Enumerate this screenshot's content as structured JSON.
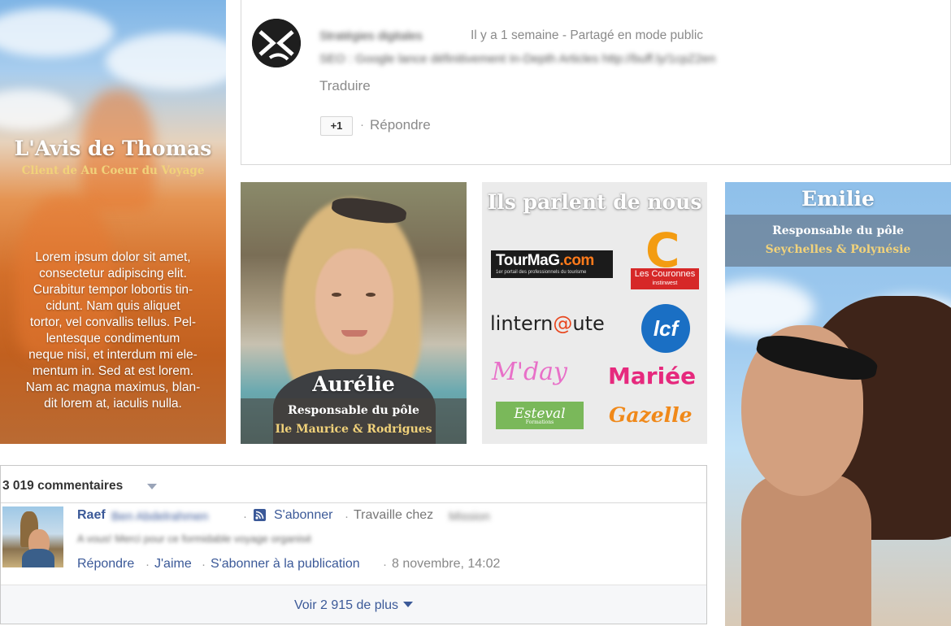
{
  "testimonial": {
    "title": "L'Avis de Thomas",
    "subtitle": "Client de Au Coeur du Voyage",
    "body_lines": [
      "Lorem ipsum dolor sit amet,",
      "consectetur adipiscing elit.",
      "Curabitur tempor lobortis tin-",
      "cidunt. Nam quis aliquet",
      "tortor, vel convallis tellus. Pel-",
      "lentesque condimentum",
      "neque nisi, et interdum mi ele-",
      "mentum in. Sed at est lorem.",
      "Nam ac magna maximus, blan-",
      "dit lorem at, iaculis nulla."
    ]
  },
  "google_comment": {
    "author": "Stratégies digitales",
    "meta": "Il y a 1 semaine  -  Partagé en mode public",
    "content": "SEO : Google lance définitivement In-Depth Articles http://buff.ly/1cpZ2en",
    "translate_label": "Traduire",
    "plus_one_label": "+1",
    "separator": "·",
    "reply_label": "Répondre"
  },
  "aurelie": {
    "name": "Aurélie",
    "role": "Responsable du pôle",
    "region": "Ile Maurice & Rodrigues"
  },
  "press": {
    "title": "Ils parlent de nous",
    "logos": {
      "tourmag_main": "TourMaG",
      "tourmag_dot": ".com",
      "tourmag_tagline": "1er portail des professionnels du tourisme",
      "couronnes_letter": "C",
      "couronnes_label": "Les Couronnes",
      "couronnes_sub": "instinwest",
      "linternaute_pre": "lintern",
      "linternaute_o": "@",
      "linternaute_post": "ute",
      "lcf": "lcf",
      "mday": "M'day",
      "mariee": "Mariée",
      "esteval": "Esteval",
      "esteval_sub": "Formations",
      "gazelle": "Gazelle"
    }
  },
  "emilie": {
    "name": "Emilie",
    "role": "Responsable du pôle",
    "region": "Seychelles & Polynésie"
  },
  "facebook": {
    "comment_count": "3 019 commentaires",
    "author_first": "Raef",
    "author_last": "Ben Abdelrahmen",
    "dot": "·",
    "subscribe_label": "S'abonner",
    "works_label": "Travaille chez",
    "employer": "Mission",
    "comment_text": "A vous! Merci pour ce formidable voyage organisé",
    "actions": {
      "reply": "Répondre",
      "like": "J'aime",
      "subscribe_post": "S'abonner à la publication"
    },
    "date": "8 novembre, 14:02",
    "more_label": "Voir 2 915 de plus"
  },
  "colors": {
    "facebook_blue": "#3b5998",
    "gold_accent": "#f1d27a",
    "muted_gray": "#8a8a8a"
  }
}
